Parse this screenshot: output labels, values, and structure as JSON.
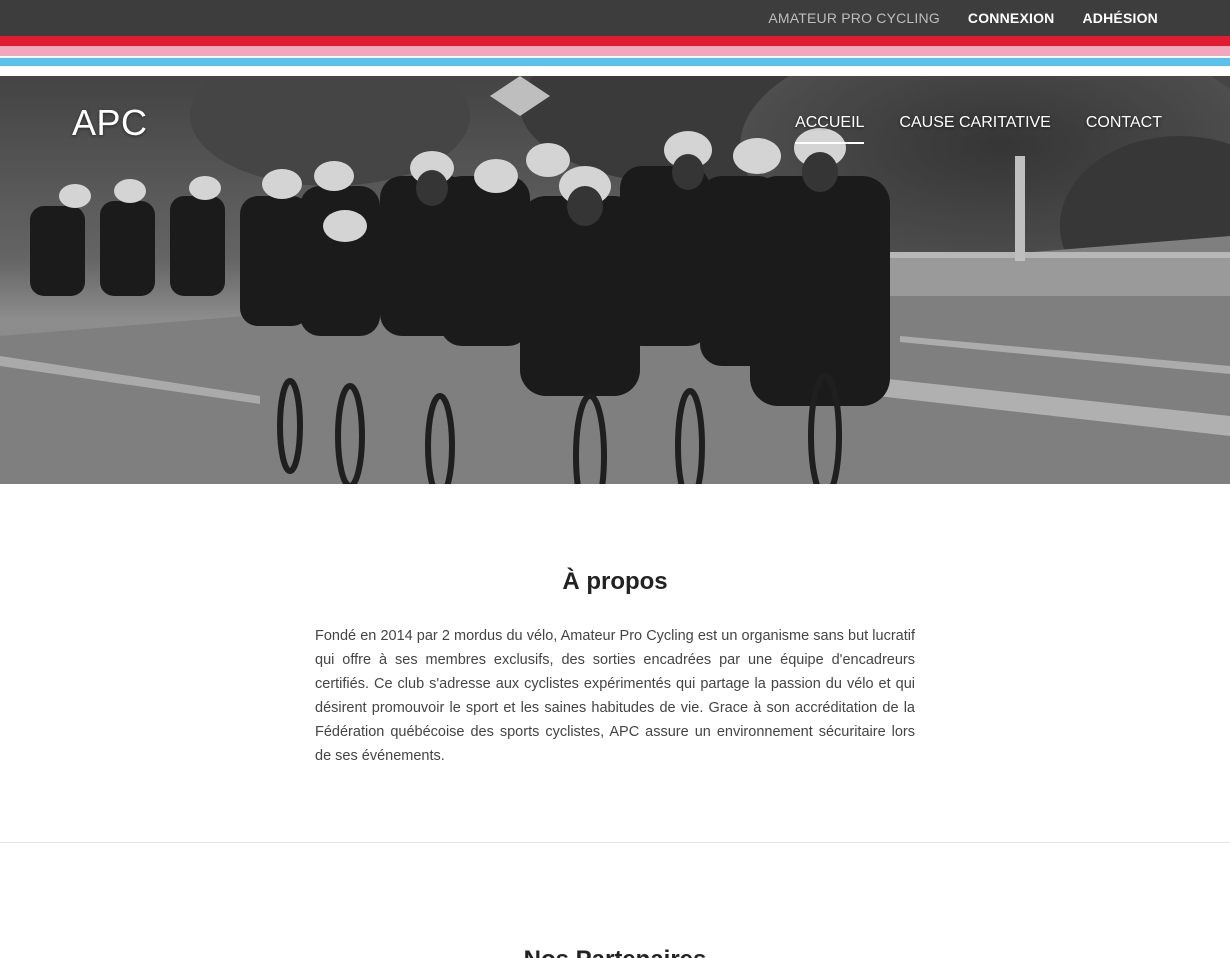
{
  "topbar": {
    "brand": "AMATEUR PRO CYCLING",
    "login": "CONNEXION",
    "membership": "ADHÉSION"
  },
  "colors": {
    "topbar_bg": "#3d3d3d",
    "stripe_red": "#e21b33",
    "stripe_pink": "#f2a7bf",
    "stripe_blue": "#5bc2ec"
  },
  "hero": {
    "logo": "APC",
    "nav": [
      {
        "label": "ACCUEIL",
        "active": true
      },
      {
        "label": "CAUSE CARITATIVE",
        "active": false
      },
      {
        "label": "CONTACT",
        "active": false
      }
    ]
  },
  "about": {
    "title": "À propos",
    "text": "Fondé en 2014 par 2 mordus du vélo, Amateur Pro Cycling est un organisme sans but lucratif qui offre à ses membres exclusifs, des sorties encadrées par une équipe d'encadreurs certifiés. Ce club s'adresse aux cyclistes expérimentés qui partage la passion du vélo et qui désirent promouvoir le sport et les saines habitudes de vie. Grace à son accréditation de la Fédération québécoise des sports cyclistes, APC assure un environnement sécuritaire lors de ses événements."
  },
  "next_section": {
    "title": "Nos Partenaires"
  }
}
